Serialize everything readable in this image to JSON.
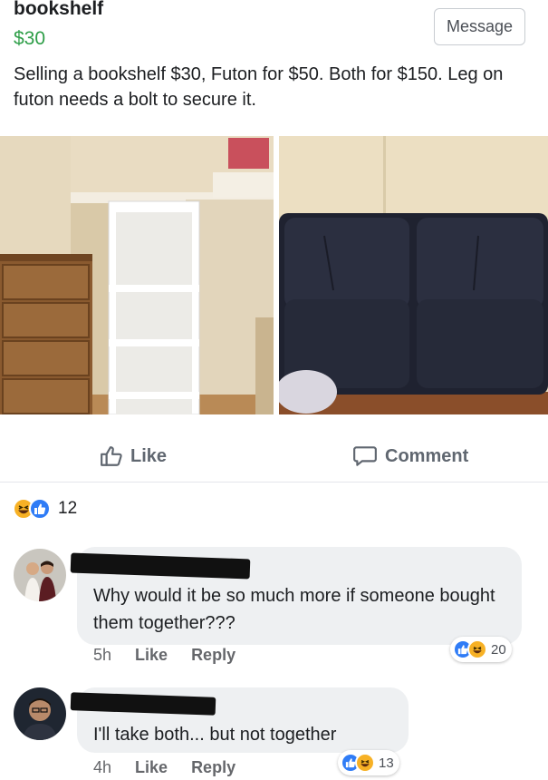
{
  "listing": {
    "title": "bookshelf",
    "price": "$30",
    "message_label": "Message",
    "description": "Selling a bookshelf $30, Futon for $50. Both for $150.  Leg on futon needs a bolt to secure it."
  },
  "actions": {
    "like_label": "Like",
    "comment_label": "Comment"
  },
  "reactions": {
    "icons": [
      "haha-icon",
      "like-icon"
    ],
    "count": "12"
  },
  "comments": [
    {
      "text": "Why would it be so much more if someone bought them together???",
      "time": "5h",
      "like_label": "Like",
      "reply_label": "Reply",
      "reaction_count": "20"
    },
    {
      "text": "I'll take both... but not together",
      "time": "4h",
      "like_label": "Like",
      "reply_label": "Reply",
      "reaction_count": "13"
    }
  ],
  "colors": {
    "price_green": "#2e9e48",
    "like_blue": "#2f7cf6",
    "haha_yellow": "#f7b125",
    "bubble_gray": "#eef0f2"
  }
}
